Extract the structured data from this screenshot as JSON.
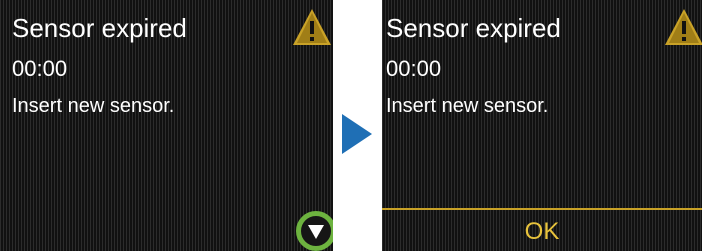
{
  "screen_before": {
    "title": "Sensor expired",
    "time": "00:00",
    "message": "Insert new sensor.",
    "warning_icon": "warning-triangle-icon",
    "scroll_icon": "scroll-down-icon"
  },
  "transition_icon": "next-step-arrow-icon",
  "screen_after": {
    "title": "Sensor expired",
    "time": "00:00",
    "message": "Insert new sensor.",
    "warning_icon": "warning-triangle-icon",
    "ok_label": "OK"
  },
  "colors": {
    "screen_bg": "#161616",
    "text": "#ffffff",
    "warning": "#c9a227",
    "highlight_ring": "#6db33f",
    "arrow": "#1f6fb5",
    "ok": "#e8c33c"
  }
}
